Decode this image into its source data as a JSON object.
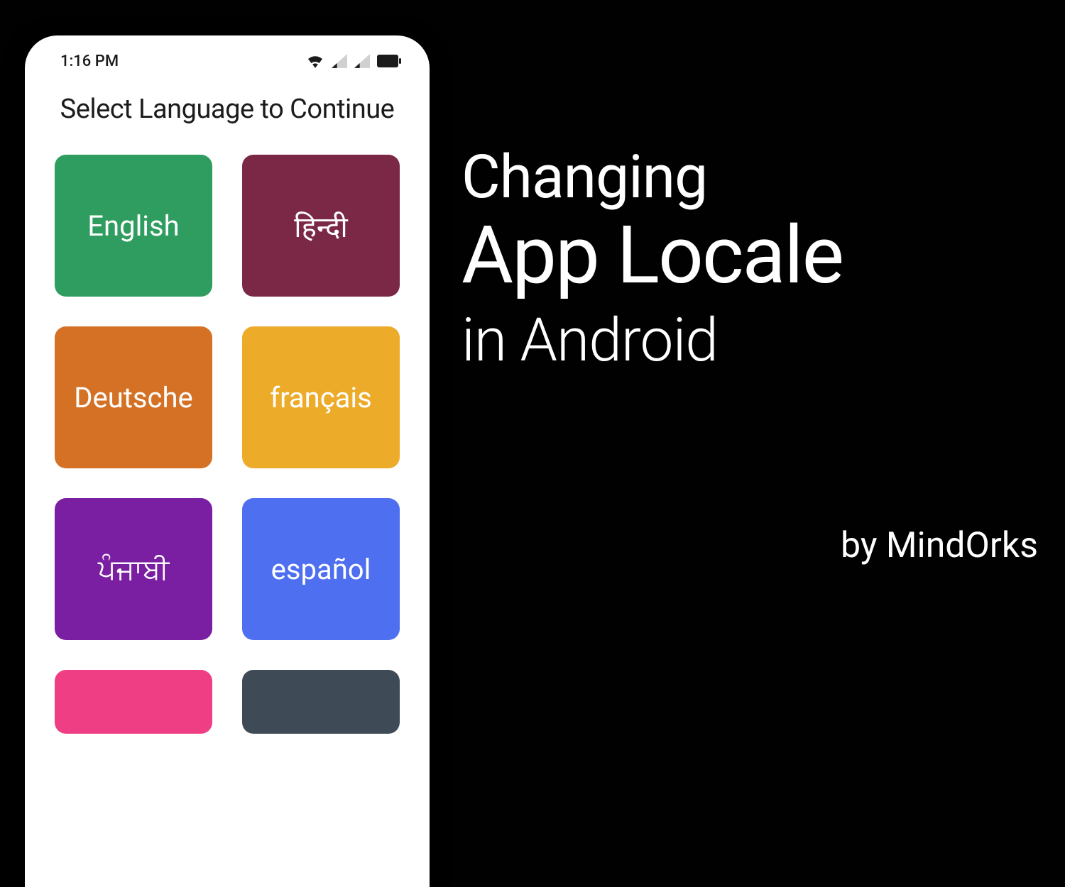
{
  "status": {
    "time": "1:16 PM"
  },
  "screen": {
    "title": "Select Language to Continue"
  },
  "languages": [
    {
      "label": "English",
      "color": "#2f9d5f"
    },
    {
      "label": "हिन्दी",
      "color": "#7b2846"
    },
    {
      "label": "Deutsche",
      "color": "#d47125"
    },
    {
      "label": "français",
      "color": "#edab2a"
    },
    {
      "label": "ਪੰਜਾਬੀ",
      "color": "#7b1fa2"
    },
    {
      "label": "español",
      "color": "#4e6ff0"
    },
    {
      "label": "",
      "color": "#ef3e84"
    },
    {
      "label": "",
      "color": "#3e4a55"
    }
  ],
  "hero": {
    "line1": "Changing",
    "line2": "App Locale",
    "line3": "in Android"
  },
  "byline": "by MindOrks"
}
